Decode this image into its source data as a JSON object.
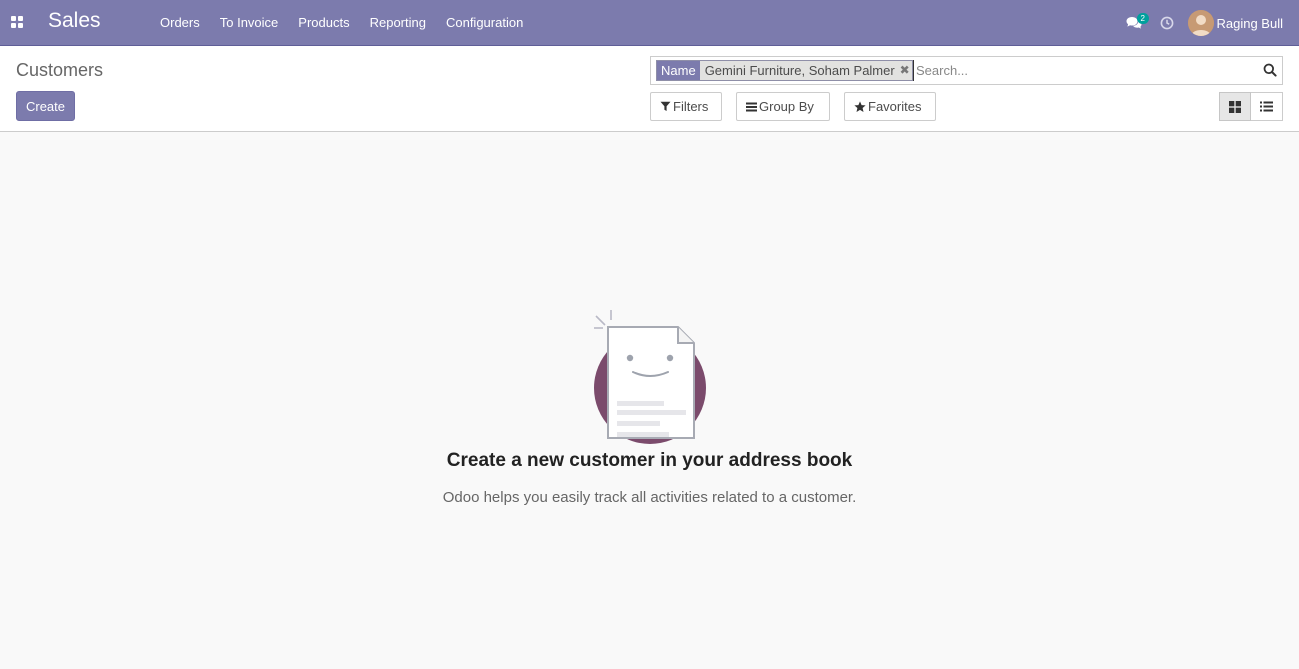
{
  "navbar": {
    "app_name": "Sales",
    "menu": [
      {
        "label": "Orders"
      },
      {
        "label": "To Invoice"
      },
      {
        "label": "Products"
      },
      {
        "label": "Reporting"
      },
      {
        "label": "Configuration"
      }
    ],
    "messages_count": "2",
    "user_name": "Raging Bull",
    "brand_color": "#7c7bad"
  },
  "control_panel": {
    "breadcrumb": "Customers",
    "create_label": "Create",
    "search": {
      "facet_category": "Name",
      "facet_values": "Gemini Furniture, Soham Palmer",
      "placeholder": "Search..."
    },
    "filters_label": "Filters",
    "groupby_label": "Group By",
    "favorites_label": "Favorites",
    "views": [
      {
        "name": "kanban",
        "icon": "kanban-view-icon",
        "active": true
      },
      {
        "name": "list",
        "icon": "list-view-icon",
        "active": false
      }
    ]
  },
  "empty_state": {
    "title": "Create a new customer in your address book",
    "text": "Odoo helps you easily track all activities related to a customer."
  }
}
